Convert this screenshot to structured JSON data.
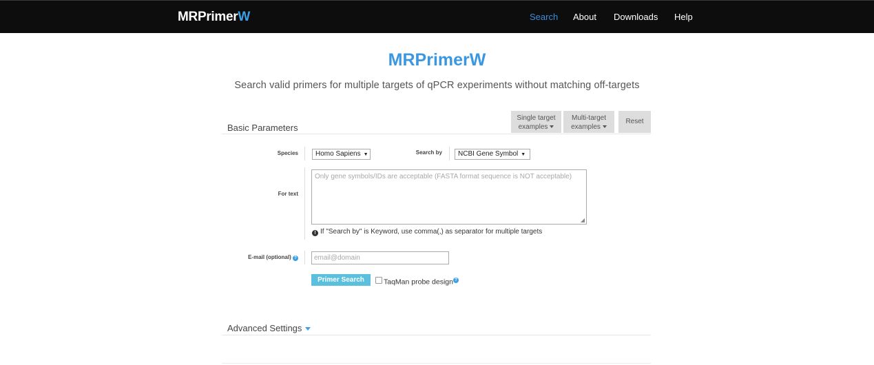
{
  "navbar": {
    "brand_main": "MRPrimer",
    "brand_suffix": "W",
    "links": [
      {
        "label": "Search",
        "active": true
      },
      {
        "label": "About",
        "active": false
      },
      {
        "label": "Downloads",
        "active": false
      },
      {
        "label": "Help",
        "active": false
      }
    ]
  },
  "header": {
    "title": "MRPrimerW",
    "subtitle": "Search valid primers for multiple targets of qPCR experiments without matching off-targets"
  },
  "basic": {
    "section_title": "Basic Parameters",
    "single_target_line1": "Single target",
    "single_target_line2": "examples",
    "multi_target_line1": "Multi-target",
    "multi_target_line2": "examples",
    "reset_label": "Reset"
  },
  "form": {
    "species_label": "Species",
    "species_value": "Homo Sapiens",
    "search_by_label": "Search by",
    "search_by_value": "NCBI Gene Symbol",
    "for_text_label": "For text",
    "for_text_placeholder": "Only gene symbols/IDs are acceptable (FASTA format sequence is NOT acceptable)",
    "help_text": "If \"Search by\" is Keyword, use comma(,) as separator for multiple targets",
    "email_label": "E-mail (optional)",
    "email_placeholder": "email@domain",
    "submit_label": "Primer Search",
    "taqman_label": "TaqMan probe design"
  },
  "advanced": {
    "title": "Advanced Settings"
  },
  "colors": {
    "navbar_bg": "#0d0d0d",
    "accent": "#3b97e0",
    "primary_button": "#5bc0de",
    "gray_button": "#dddddd"
  }
}
